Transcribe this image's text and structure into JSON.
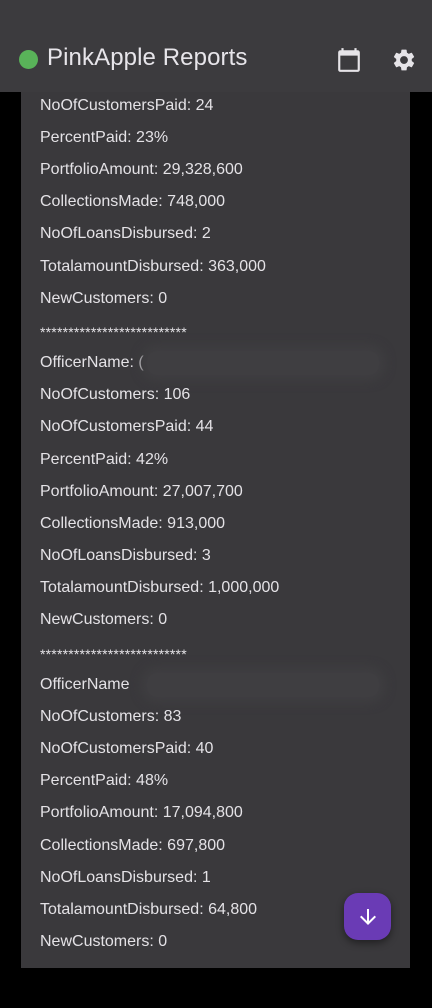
{
  "header": {
    "title": "PinkApple Reports",
    "status_color": "#59b359",
    "calendar_icon": "calendar-icon",
    "settings_icon": "gear-icon"
  },
  "report": {
    "lines": [
      "NoOfCustomersPaid: 24",
      "PercentPaid: 23%",
      "PortfolioAmount: 29,328,600",
      "CollectionsMade: 748,000",
      "NoOfLoansDisbursed: 2",
      "TotalamountDisbursed: 363,000",
      "NewCustomers: 0",
      "**************************",
      "OfficerName: (",
      "NoOfCustomers: 106",
      "NoOfCustomersPaid: 44",
      "PercentPaid: 42%",
      "PortfolioAmount: 27,007,700",
      "CollectionsMade: 913,000",
      "NoOfLoansDisbursed: 3",
      "TotalamountDisbursed: 1,000,000",
      "NewCustomers: 0",
      "**************************",
      "OfficerName",
      "NoOfCustomers: 83",
      "NoOfCustomersPaid: 40",
      "PercentPaid: 48%",
      "PortfolioAmount: 17,094,800",
      "CollectionsMade: 697,800",
      "NoOfLoansDisbursed: 1",
      "TotalamountDisbursed: 64,800",
      "NewCustomers: 0"
    ]
  },
  "fab": {
    "icon": "arrow-down-icon",
    "color": "#6a3bb5"
  }
}
